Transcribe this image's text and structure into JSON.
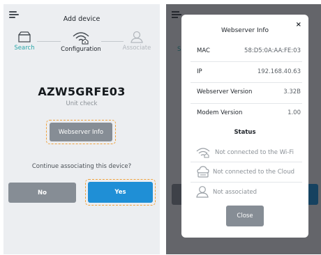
{
  "left_screen": {
    "header": {
      "title": "Add device"
    },
    "stepper": {
      "steps": [
        {
          "label": "Search",
          "icon": "box-icon",
          "state": "done"
        },
        {
          "label": "Configuration",
          "icon": "wifi-device-icon",
          "state": "active"
        },
        {
          "label": "Associate",
          "icon": "user-icon",
          "state": "pending"
        }
      ]
    },
    "device": {
      "id": "AZW5GRFE03",
      "subtitle": "Unit check"
    },
    "webserver_button": "Webserver Info",
    "question": "Continue associating this device?",
    "no_button": "No",
    "yes_button": "Yes"
  },
  "modal": {
    "title": "Webserver Info",
    "close_glyph": "×",
    "rows": [
      {
        "key": "MAC",
        "value": "58:D5:0A:AA:FE:03"
      },
      {
        "key": "IP",
        "value": "192.168.40.63"
      },
      {
        "key": "Webserver Version",
        "value": "3.32B"
      },
      {
        "key": "Modem Version",
        "value": "1.00"
      }
    ],
    "status_title": "Status",
    "status": [
      {
        "icon": "wifi-icon",
        "text": "Not connected to the Wi-Fi"
      },
      {
        "icon": "cloud-icon",
        "text": "Not connected to the Cloud"
      },
      {
        "icon": "user-icon",
        "text": "Not associated"
      }
    ],
    "close_button": "Close"
  },
  "background": {
    "partial_label": "S"
  },
  "colors": {
    "accent_teal": "#2aa6a8",
    "primary_blue": "#1f8fd6",
    "button_gray": "#868d95",
    "highlight_orange": "#f0a13a"
  }
}
